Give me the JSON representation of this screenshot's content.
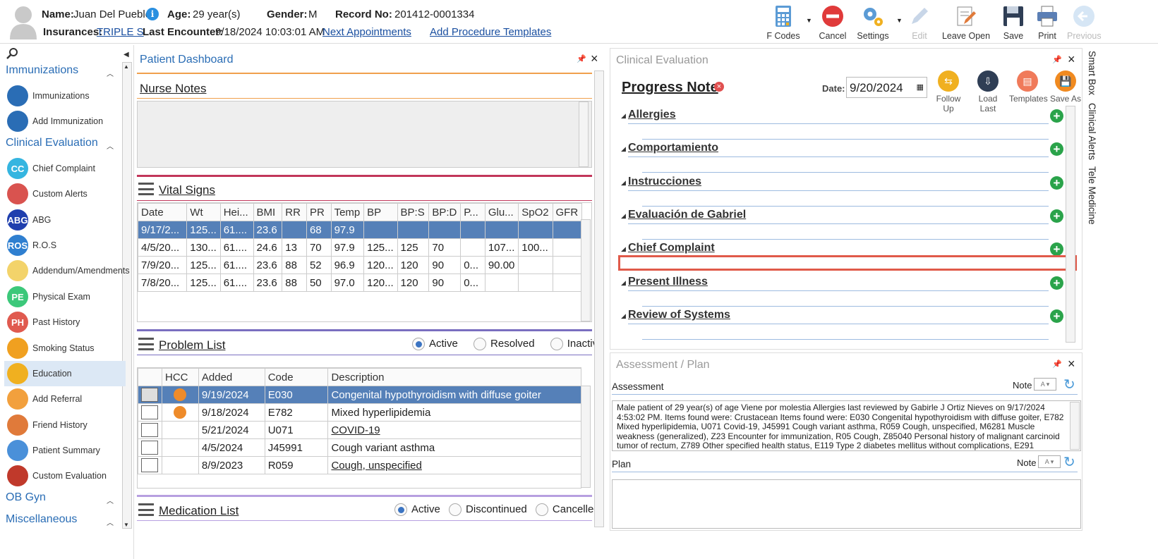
{
  "header": {
    "name_label": "Name:",
    "name": "Juan Del Pueblo",
    "age_label": "Age:",
    "age": "29 year(s)",
    "gender_label": "Gender:",
    "gender": "M",
    "record_label": "Record No:",
    "record": "201412-0001334",
    "ins_label": "Insurances:",
    "ins": "TRIPLE S",
    "last_enc_label": "Last Encounter:",
    "last_enc": "9/18/2024 10:03:01 AM",
    "next_appt": "Next Appointments",
    "add_proc": "Add Procedure Templates"
  },
  "toolbar": {
    "fcodes": "F Codes",
    "cancel": "Cancel",
    "settings": "Settings",
    "edit": "Edit",
    "leave_open": "Leave Open",
    "save": "Save",
    "print": "Print",
    "previous": "Previous"
  },
  "sidebar": {
    "sections": {
      "immunizations": "Immunizations",
      "clinical": "Clinical Evaluation",
      "obgyn": "OB Gyn",
      "misc": "Miscellaneous"
    },
    "items": [
      {
        "label": "Immunizations",
        "abbr": "",
        "color": "#2a6db5"
      },
      {
        "label": "Add Immunization",
        "abbr": "",
        "color": "#2a6db5"
      },
      {
        "label": "Chief Complaint",
        "abbr": "CC",
        "color": "#35b5e0"
      },
      {
        "label": "Custom Alerts",
        "abbr": "",
        "color": "#d9534f"
      },
      {
        "label": "ABG",
        "abbr": "ABG",
        "color": "#1f3fae"
      },
      {
        "label": "R.O.S",
        "abbr": "ROS",
        "color": "#2f7fd0"
      },
      {
        "label": "Addendum/Amendments",
        "abbr": "",
        "color": "#f3d36a"
      },
      {
        "label": "Physical Exam",
        "abbr": "PE",
        "color": "#3cc87a"
      },
      {
        "label": "Past History",
        "abbr": "PH",
        "color": "#e05a4f"
      },
      {
        "label": "Smoking Status",
        "abbr": "",
        "color": "#f0a020"
      },
      {
        "label": "Education",
        "abbr": "",
        "color": "#f0b020"
      },
      {
        "label": "Add Referral",
        "abbr": "",
        "color": "#f2a03d"
      },
      {
        "label": "Friend History",
        "abbr": "",
        "color": "#e07a3a"
      },
      {
        "label": "Patient Summary",
        "abbr": "",
        "color": "#4a90d9"
      },
      {
        "label": "Custom Evaluation",
        "abbr": "",
        "color": "#c0392b"
      }
    ]
  },
  "dashboard": {
    "title": "Patient Dashboard",
    "nurse_notes": "Nurse Notes",
    "vital_signs": "Vital Signs",
    "vitals_cols": [
      "Date",
      "Wt",
      "Hei...",
      "BMI",
      "RR",
      "PR",
      "Temp",
      "BP",
      "BP:S",
      "BP:D",
      "P...",
      "Glu...",
      "SpO2",
      "GFR"
    ],
    "vitals_rows": [
      [
        "9/17/2...",
        "125...",
        "61....",
        "23.6",
        "",
        "68",
        "97.9",
        "",
        "",
        "",
        "",
        "",
        "",
        ""
      ],
      [
        "4/5/20...",
        "130...",
        "61....",
        "24.6",
        "13",
        "70",
        "97.9",
        "125...",
        "125",
        "70",
        "",
        "107...",
        "100...",
        ""
      ],
      [
        "7/9/20...",
        "125...",
        "61....",
        "23.6",
        "88",
        "52",
        "96.9",
        "120...",
        "120",
        "90",
        "0...",
        "90.00",
        "",
        ""
      ],
      [
        "7/8/20...",
        "125...",
        "61....",
        "23.6",
        "88",
        "50",
        "97.0",
        "120...",
        "120",
        "90",
        "0...",
        "",
        "",
        ""
      ]
    ],
    "problem_list": "Problem List",
    "pl_active": "Active",
    "pl_resolved": "Resolved",
    "pl_inactive": "Inactive",
    "pl_cols": [
      "HCC",
      "Added",
      "Code",
      "Description"
    ],
    "pl_rows": [
      {
        "hcc": true,
        "added": "9/19/2024",
        "code": "E030",
        "desc": "Congenital hypothyroidism with diffuse goiter",
        "link": false
      },
      {
        "hcc": true,
        "added": "9/18/2024",
        "code": "E782",
        "desc": "Mixed hyperlipidemia",
        "link": false
      },
      {
        "hcc": false,
        "added": "5/21/2024",
        "code": "U071",
        "desc": "COVID-19",
        "link": true
      },
      {
        "hcc": false,
        "added": "4/5/2024",
        "code": "J45991",
        "desc": "Cough variant asthma",
        "link": false
      },
      {
        "hcc": false,
        "added": "8/9/2023",
        "code": "R059",
        "desc": "Cough, unspecified",
        "link": true
      }
    ],
    "medication_list": "Medication List",
    "ml_active": "Active",
    "ml_discontinued": "Discontinued",
    "ml_cancelled": "Cancelled"
  },
  "clinical": {
    "title": "Clinical Evaluation",
    "note_title": "Progress Note",
    "date_label": "Date:",
    "date": "9/20/2024",
    "buttons": {
      "follow_up": "Follow Up",
      "load_last": "Load Last",
      "templates": "Templates",
      "save_as": "Save As"
    },
    "sections": [
      "Allergies",
      "Comportamiento",
      "Instrucciones",
      "Evaluación de Gabriel",
      "Chief Complaint",
      "Present Illness",
      "Review of Systems"
    ]
  },
  "right_tabs": {
    "smart_box": "Smart Box",
    "clinical_alerts": "Clinical Alerts",
    "tele_medicine": "Tele Medicine"
  },
  "assessment": {
    "title": "Assessment / Plan",
    "assessment_label": "Assessment",
    "note": "Note",
    "text": "Male patient of 29 year(s) of age Viene por molestia     Allergies last reviewed by Gabirle J Ortiz Nieves on 9/17/2024 4:53:02 PM.    Items found were:  Crustacean  Items found were:  E030 Congenital hypothyroidism with diffuse goiter, E782 Mixed hyperlipidemia, U071 Covid-19, J45991 Cough variant asthma, R059 Cough, unspecified, M6281 Muscle weakness (generalized), Z23 Encounter for immunization, R05 Cough, Z85040 Personal history of malignant carcinoid tumor of rectum, Z789 Other specified health status, E119 Type 2 diabetes mellitus without complications, E291",
    "plan_label": "Plan",
    "plan_note": "Note"
  }
}
